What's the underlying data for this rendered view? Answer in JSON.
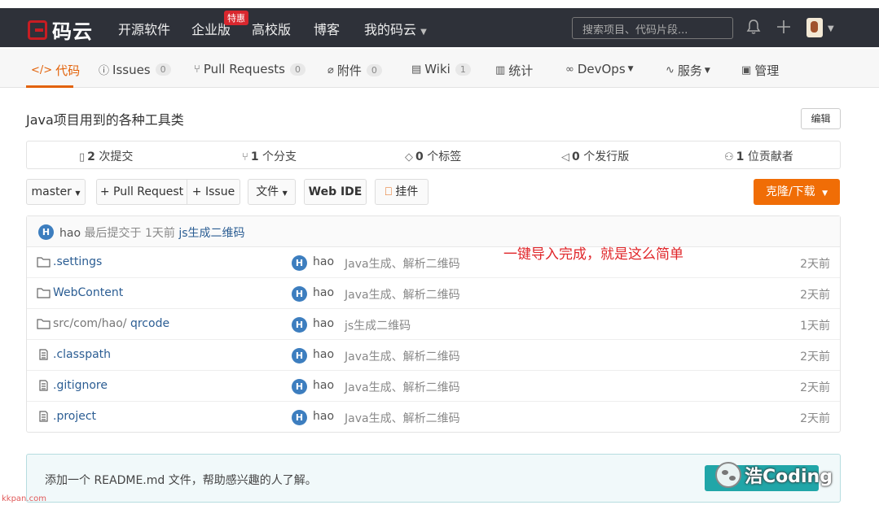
{
  "topnav": {
    "logo": "码云",
    "items": [
      "开源软件",
      "企业版",
      "高校版",
      "博客",
      "我的码云"
    ],
    "hot_badge": "特惠",
    "search_placeholder": "搜索项目、代码片段..."
  },
  "tabs": [
    {
      "label": "代码",
      "icon": "code-icon"
    },
    {
      "label": "Issues",
      "count": "0",
      "icon": "issue-icon"
    },
    {
      "label": "Pull Requests",
      "count": "0",
      "icon": "pull-request-icon"
    },
    {
      "label": "附件",
      "count": "0",
      "icon": "paperclip-icon"
    },
    {
      "label": "Wiki",
      "count": "1",
      "icon": "book-icon"
    },
    {
      "label": "统计",
      "icon": "bar-chart-icon"
    },
    {
      "label": "DevOps",
      "icon": "infinity-icon"
    },
    {
      "label": "服务",
      "icon": "pulse-icon"
    },
    {
      "label": "管理",
      "icon": "clipboard-icon"
    }
  ],
  "repo": {
    "description": "Java项目用到的各种工具类",
    "edit_label": "编辑"
  },
  "stats": [
    {
      "count": "2",
      "label": "次提交"
    },
    {
      "count": "1",
      "label": "个分支"
    },
    {
      "count": "0",
      "label": "个标签"
    },
    {
      "count": "0",
      "label": "个发行版"
    },
    {
      "count": "1",
      "label": "位贡献者"
    }
  ],
  "toolbar": {
    "branch": "master",
    "pull_request": "+ Pull Request",
    "issue": "+ Issue",
    "file": "文件",
    "web_ide": "Web IDE",
    "widget": "挂件",
    "clone": "克隆/下载"
  },
  "last_commit": {
    "avatar": "H",
    "author": "hao",
    "prefix": "最后提交于",
    "time": "1天前",
    "message": "js生成二维码"
  },
  "files": [
    {
      "type": "folder",
      "name": ".settings",
      "author": "hao",
      "message": "Java生成、解析二维码",
      "time": "2天前"
    },
    {
      "type": "folder",
      "name": "WebContent",
      "author": "hao",
      "message": "Java生成、解析二维码",
      "time": "2天前"
    },
    {
      "type": "folder",
      "path": "src/com/hao/",
      "name": "qrcode",
      "author": "hao",
      "message": "js生成二维码",
      "time": "1天前"
    },
    {
      "type": "file",
      "name": ".classpath",
      "author": "hao",
      "message": "Java生成、解析二维码",
      "time": "2天前"
    },
    {
      "type": "file",
      "name": ".gitignore",
      "author": "hao",
      "message": "Java生成、解析二维码",
      "time": "2天前"
    },
    {
      "type": "file",
      "name": ".project",
      "author": "hao",
      "message": "Java生成、解析二维码",
      "time": "2天前"
    }
  ],
  "annotation": "一键导入完成，就是这么简单",
  "readme": {
    "text": "添加一个 README.md 文件，帮助感兴趣的人了解。"
  },
  "watermark": {
    "text": "浩Coding",
    "site": "kkpan.com"
  },
  "colors": {
    "topbar": "#2e3139",
    "accent": "#e36209",
    "clone_button": "#f06d06",
    "link": "#2b5d93",
    "annotation": "#e0262a"
  }
}
